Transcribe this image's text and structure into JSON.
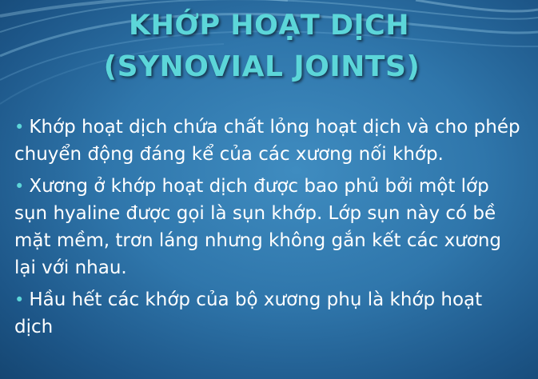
{
  "slide": {
    "title_line1": "KHỚP HOẠT DỊCH",
    "title_line2": "(SYNOVIAL JOINTS)",
    "bullet_char": "•",
    "bullets": [
      "Khớp hoạt dịch chứa chất lỏng hoạt dịch và cho phép chuyển động đáng kể của các xương nối khớp.",
      "Xương ở khớp hoạt dịch được bao phủ bởi một lớp sụn hyaline được gọi là sụn khớp. Lớp sụn này có bề mặt mềm, trơn láng nhưng không gắn kết các xương lại với nhau.",
      "Hầu hết các khớp của bộ xương phụ là khớp hoạt dịch"
    ]
  },
  "colors": {
    "background": "#2f76ab",
    "title": "#5cd6d9",
    "body_text": "#ffffff"
  }
}
